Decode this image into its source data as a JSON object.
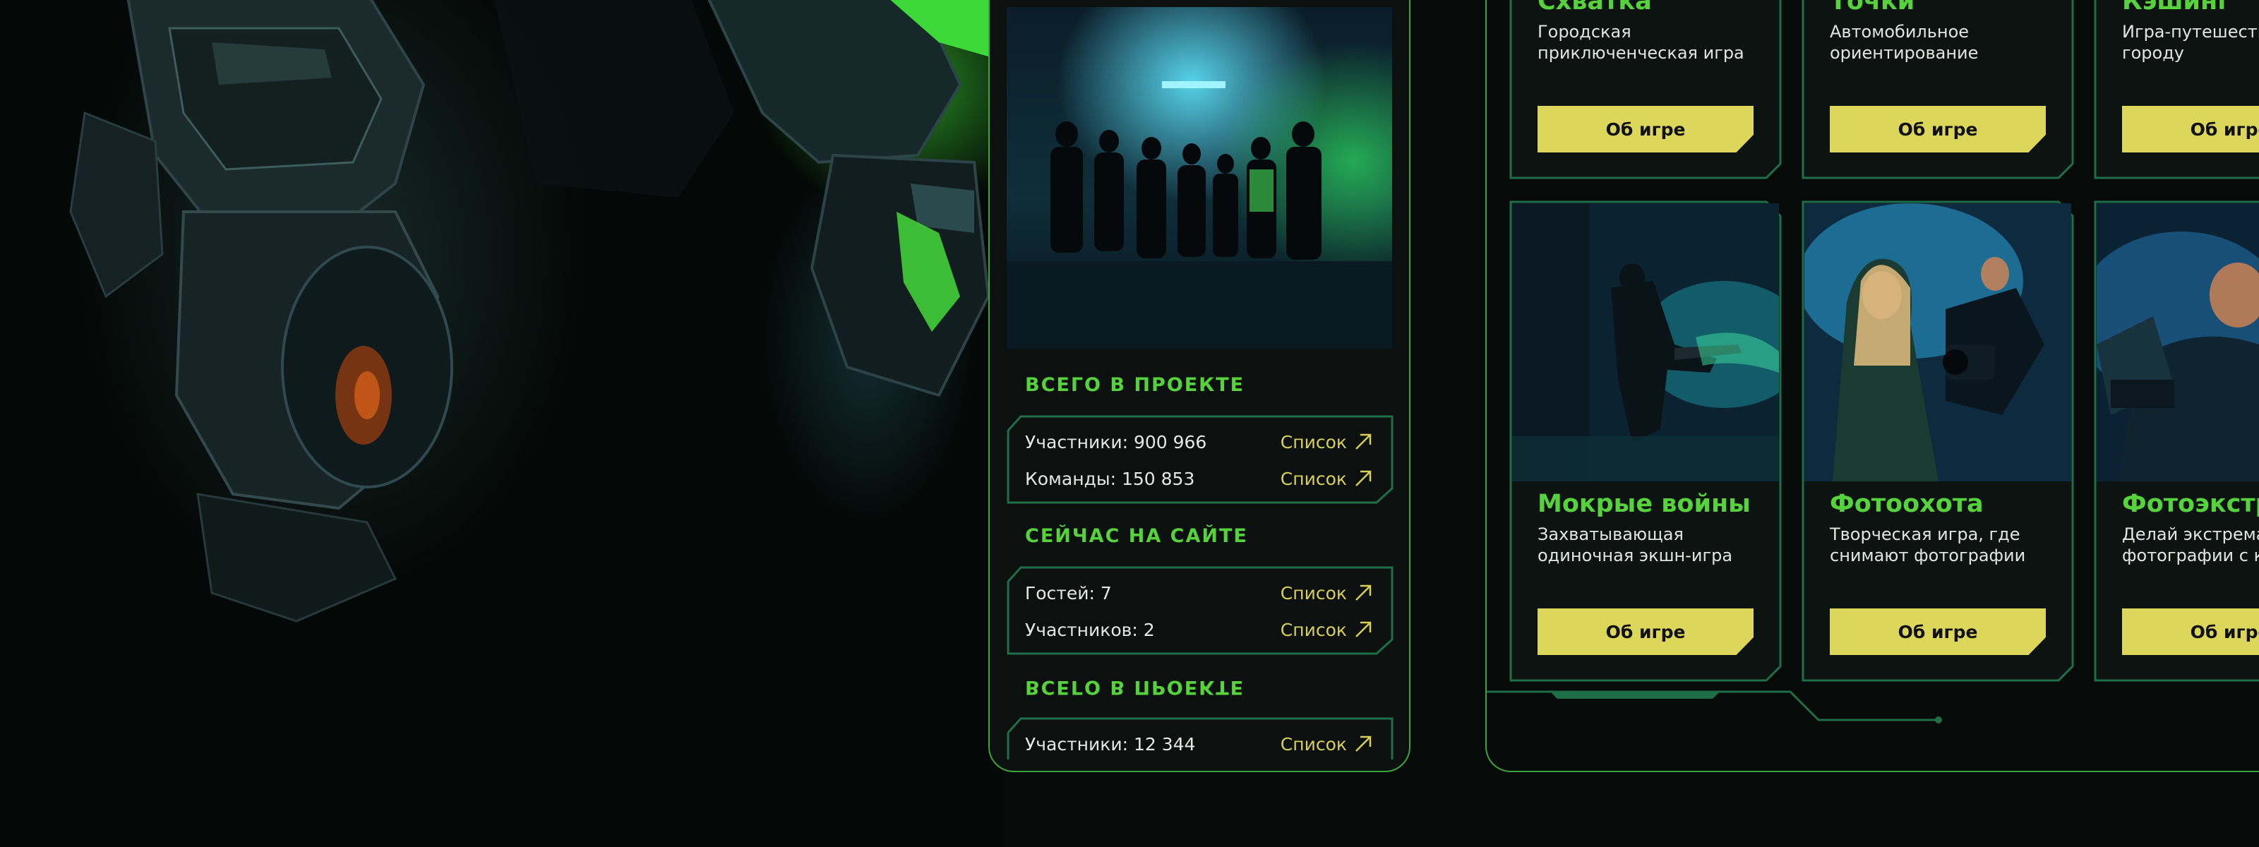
{
  "stats": {
    "total": {
      "title": "ВСЕГО В ПРОЕКТЕ",
      "rows": [
        {
          "label": "Участники: 900 966",
          "link": "Список"
        },
        {
          "label": "Команды: 150 853",
          "link": "Список"
        }
      ]
    },
    "online": {
      "title": "СЕЙЧАС НА САЙТЕ",
      "rows": [
        {
          "label": "Гостей: 7",
          "link": "Список"
        },
        {
          "label": "Участников: 2",
          "link": "Список"
        }
      ]
    },
    "mirrored": {
      "title": "ВСЕГО В ПРОЕКТЕ",
      "rows": [
        {
          "label": "Участники: 12 344",
          "link": "Список"
        }
      ]
    }
  },
  "games": [
    {
      "title": "Схватка",
      "desc": "Городская приключенческая игра",
      "button": "Об игре"
    },
    {
      "title": "Точки",
      "desc": "Автомобильное ориентирование",
      "button": "Об игре"
    },
    {
      "title": "Кэшинг",
      "desc": "Игра-путешествие по городу",
      "button": "Об игре"
    },
    {
      "title": "Мокрые войны",
      "desc": "Захватывающая одиночная экшн-игра",
      "button": "Об игре"
    },
    {
      "title": "Фотоохота",
      "desc": "Творческая игра, где снимают фотографии",
      "button": "Об игре"
    },
    {
      "title": "Фотоэкстрим",
      "desc": "Делай экстремальные фотографии с командой",
      "button": "Об игре"
    }
  ],
  "icons": {
    "list_link": "arrow-up-right-icon"
  },
  "colors": {
    "accent_green": "#56d23c",
    "accent_yellow": "#dcd65b",
    "frame_green": "#1f6e4a",
    "panel_border": "#3aa53a"
  }
}
